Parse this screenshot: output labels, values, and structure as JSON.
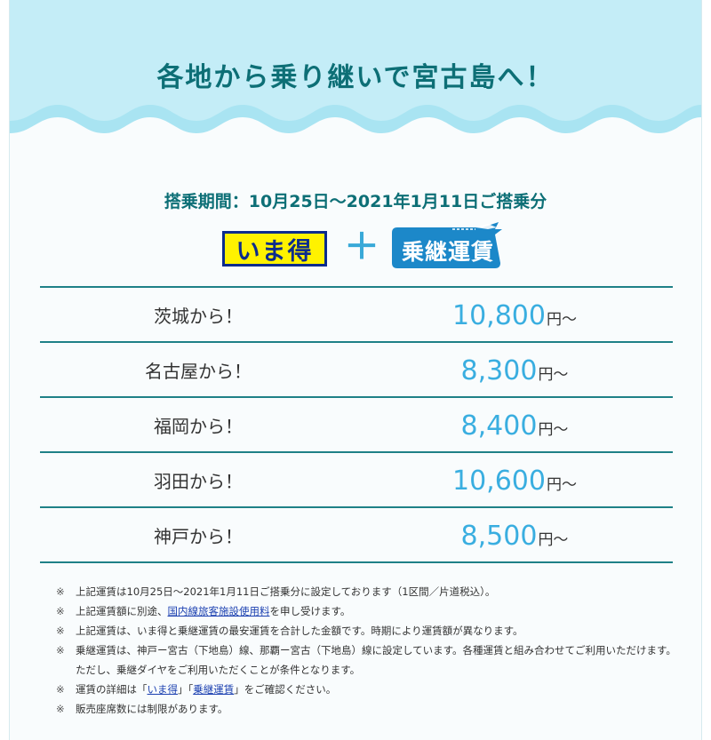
{
  "banner": {
    "title": "各地から乗り継いで宮古島へ！"
  },
  "period": "搭乗期間：10月25日～2021年1月11日ご搭乗分",
  "logos": {
    "imatoku": "いま得",
    "plus": "＋",
    "norikae": "乗継運賃"
  },
  "fares": [
    {
      "origin": "茨城から！",
      "amount": "10,800",
      "unit": "円～"
    },
    {
      "origin": "名古屋から！",
      "amount": "8,300",
      "unit": "円～"
    },
    {
      "origin": "福岡から！",
      "amount": "8,400",
      "unit": "円～"
    },
    {
      "origin": "羽田から！",
      "amount": "10,600",
      "unit": "円～"
    },
    {
      "origin": "神戸から！",
      "amount": "8,500",
      "unit": "円～"
    }
  ],
  "notes": {
    "mark": "※",
    "n1": "上記運賃は10月25日～2021年1月11日ご搭乗分に設定しております（1区間／片道税込）。",
    "n2_pre": "上記運賃額に別途、",
    "n2_link": "国内線旅客施設使用料",
    "n2_post": "を申し受けます。",
    "n3": "上記運賃は、いま得と乗継運賃の最安運賃を合計した金額です。時期により運賃額が異なります。",
    "n4": "乗継運賃は、神戸ー宮古（下地島）線、那覇ー宮古（下地島）線に設定しています。各種運賃と組み合わせてご利用いただけます。ただし、乗継ダイヤをご利用いただくことが条件となります。",
    "n5_pre": "運賃の詳細は「",
    "n5_link1": "いま得",
    "n5_mid": "」「",
    "n5_link2": "乗継運賃",
    "n5_post": "」をご確認ください。",
    "n6": "販売座席数には制限があります。"
  },
  "colors": {
    "accent": "#0d6f76",
    "price": "#3aaee0",
    "wave": "#a9e4f2",
    "link": "#1a3fb0"
  }
}
